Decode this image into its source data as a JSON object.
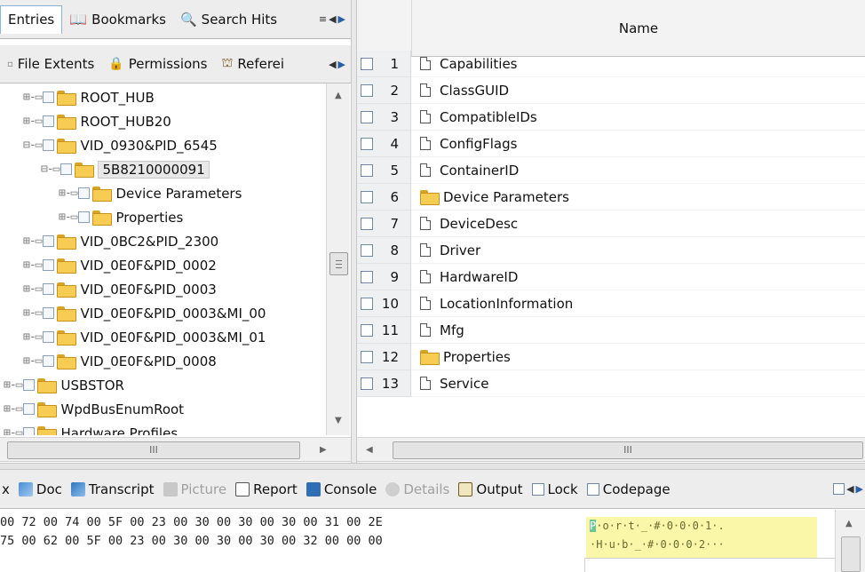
{
  "left_tabs": [
    {
      "label": "Entries",
      "icon": "entries-icon",
      "active": true
    },
    {
      "label": "Bookmarks",
      "icon": "bookmarks-icon"
    },
    {
      "label": "Search Hits",
      "icon": "search-hits-icon"
    }
  ],
  "left_tabs2": [
    {
      "label": "File Extents",
      "icon": "file-extents-icon"
    },
    {
      "label": "Permissions",
      "icon": "permissions-icon"
    },
    {
      "label": "Referei",
      "icon": "references-icon"
    }
  ],
  "tree": [
    {
      "prefix": "⊞-▭",
      "label": "ROOT_HUB"
    },
    {
      "prefix": "⊞-▭",
      "label": "ROOT_HUB20"
    },
    {
      "prefix": "⊟-▭",
      "label": "VID_0930&PID_6545"
    },
    {
      "prefix": "⊟-▭",
      "label": "5B8210000091"
    },
    {
      "prefix": "⊞-▭",
      "label": "Device Parameters"
    },
    {
      "prefix": "⊞-▭",
      "label": "Properties"
    },
    {
      "prefix": "⊞-▭",
      "label": "VID_0BC2&PID_2300"
    },
    {
      "prefix": "⊞-▭",
      "label": "VID_0E0F&PID_0002"
    },
    {
      "prefix": "⊞-▭",
      "label": "VID_0E0F&PID_0003"
    },
    {
      "prefix": "⊞-▭",
      "label": "VID_0E0F&PID_0003&MI_00"
    },
    {
      "prefix": "⊞-▭",
      "label": "VID_0E0F&PID_0003&MI_01"
    },
    {
      "prefix": "⊞-▭",
      "label": "VID_0E0F&PID_0008"
    },
    {
      "prefix": "⊞-▭",
      "label": "USBSTOR"
    },
    {
      "prefix": "⊞-▭",
      "label": "WpdBusEnumRoot"
    },
    {
      "prefix": "⊞-▭",
      "label": "Hardware Profiles"
    }
  ],
  "list_header": {
    "name": "Name"
  },
  "list_rows": [
    {
      "num": "1",
      "name": "Capabilities",
      "kind": "file"
    },
    {
      "num": "2",
      "name": "ClassGUID",
      "kind": "file"
    },
    {
      "num": "3",
      "name": "CompatibleIDs",
      "kind": "file"
    },
    {
      "num": "4",
      "name": "ConfigFlags",
      "kind": "file"
    },
    {
      "num": "5",
      "name": "ContainerID",
      "kind": "file"
    },
    {
      "num": "6",
      "name": "Device Parameters",
      "kind": "folder"
    },
    {
      "num": "7",
      "name": "DeviceDesc",
      "kind": "file"
    },
    {
      "num": "8",
      "name": "Driver",
      "kind": "file"
    },
    {
      "num": "9",
      "name": "HardwareID",
      "kind": "file"
    },
    {
      "num": "10",
      "name": "LocationInformation",
      "kind": "file"
    },
    {
      "num": "11",
      "name": "Mfg",
      "kind": "file"
    },
    {
      "num": "12",
      "name": "Properties",
      "kind": "folder"
    },
    {
      "num": "13",
      "name": "Service",
      "kind": "file"
    }
  ],
  "scroll_grip": "III",
  "bottom_tabs": [
    {
      "label": "x",
      "icon": ""
    },
    {
      "label": "Doc",
      "icon": "doc-icon"
    },
    {
      "label": "Transcript",
      "icon": "transcript-icon"
    },
    {
      "label": "Picture",
      "icon": "picture-icon",
      "disabled": true
    },
    {
      "label": "Report",
      "icon": "report-icon"
    },
    {
      "label": "Console",
      "icon": "console-icon"
    },
    {
      "label": "Details",
      "icon": "details-icon",
      "disabled": true
    },
    {
      "label": "Output",
      "icon": "output-icon"
    },
    {
      "label": "Lock",
      "icon": "lock-checkbox"
    },
    {
      "label": "Codepage",
      "icon": "codepage-checkbox"
    }
  ],
  "hex_lines": [
    "00 72 00 74 00 5F 00 23 00 30 00 30 00 30 00 31 00 2E",
    "75 00 62 00 5F 00 23 00 30 00 30 00 30 00 32 00 00 00"
  ],
  "ascii_lines": [
    {
      "cursor": "P",
      "rest": "·o·r·t·_·#·0·0·0·1·."
    },
    {
      "cursor": "",
      "rest": "·H·u·b·_·#·0·0·0·2···"
    }
  ],
  "colors": {
    "accent": "#8fb3d9",
    "folder": "#f6cc52",
    "highlight": "#fbf7a8",
    "cursor": "#6cc49a"
  }
}
